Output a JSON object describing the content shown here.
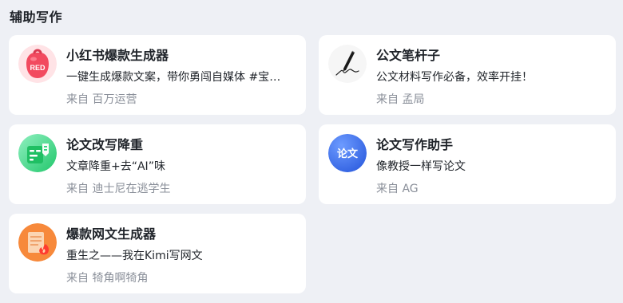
{
  "section": {
    "title": "辅助写作"
  },
  "cards": [
    {
      "title": "小红书爆款生成器",
      "description": "一键生成爆款文案，带你勇闯自媒体 #宝宝们",
      "author_prefix": "来自",
      "author": "百万运营",
      "avatar_icon": "red-badge-icon",
      "avatar_text": "RED",
      "avatar_color": "#f24a5f"
    },
    {
      "title": "公文笔杆子",
      "description": "公文材料写作必备，效率开挂！",
      "author_prefix": "来自",
      "author": "孟局",
      "avatar_icon": "pen-signature-icon",
      "avatar_color": "#f6f6f6"
    },
    {
      "title": "论文改写降重",
      "description": "文章降重+去“AI”味",
      "author_prefix": "来自",
      "author": "迪士尼在逃学生",
      "avatar_icon": "document-rewrite-icon",
      "avatar_color": "#2ed47a"
    },
    {
      "title": "论文写作助手",
      "description": "像教授一样写论文",
      "author_prefix": "来自",
      "author": "AG",
      "avatar_icon": "paper-text-icon",
      "avatar_text": "论文",
      "avatar_color": "#3d6ef0"
    },
    {
      "title": "爆款网文生成器",
      "description": "重生之——我在Kimi写网文",
      "author_prefix": "来自",
      "author": "犄角啊犄角",
      "avatar_icon": "book-flame-icon",
      "avatar_color": "#f7893b"
    }
  ]
}
